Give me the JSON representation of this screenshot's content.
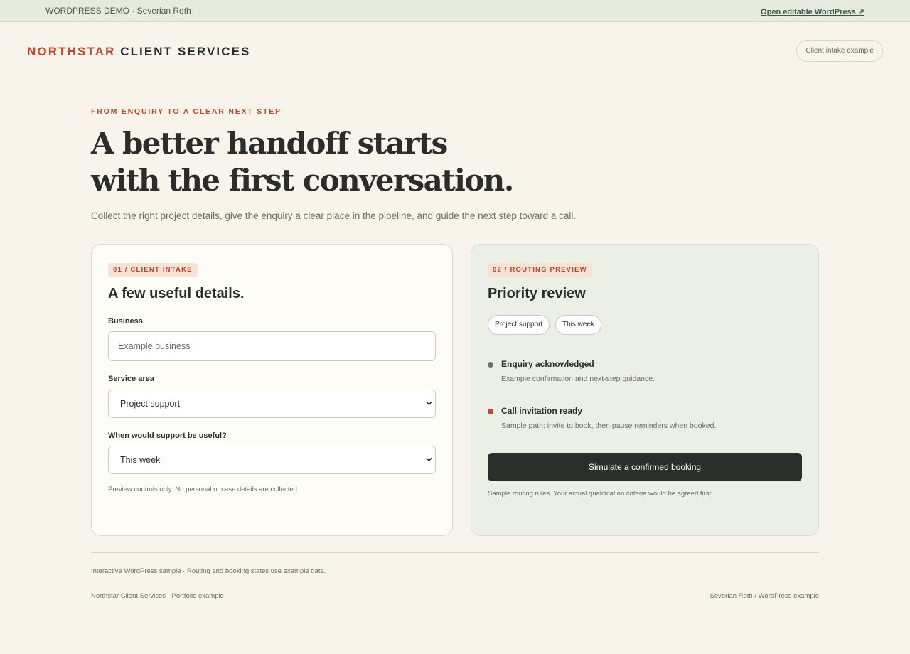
{
  "topbar": {
    "demo_label": "WORDPRESS DEMO · Severian Roth",
    "editable_link": "Open editable WordPress ↗"
  },
  "header": {
    "brand_accent": "NORTHSTAR",
    "brand_rest": "CLIENT SERVICES",
    "pill_label": "Client intake example"
  },
  "hero": {
    "eyebrow": "FROM ENQUIRY TO A CLEAR NEXT STEP",
    "title_line1": "A better handoff starts",
    "title_line2": "with the first conversation.",
    "lede": "Collect the right project details, give the enquiry a clear place in the pipeline, and guide the next step toward a call."
  },
  "intake": {
    "tag": "01 / CLIENT INTAKE",
    "title": "A few useful details.",
    "business_label": "Business",
    "business_placeholder": "Example business",
    "service_label": "Service area",
    "service_value": "Project support",
    "timing_label": "When would support be useful?",
    "timing_value": "This week",
    "note": "Preview controls only. No personal or case details are collected."
  },
  "routing": {
    "tag": "02 / ROUTING PREVIEW",
    "title": "Priority review",
    "chips": [
      "Project support",
      "This week"
    ],
    "steps": [
      {
        "title": "Enquiry acknowledged",
        "desc": "Example confirmation and next-step guidance.",
        "color": "#5f7a63"
      },
      {
        "title": "Call invitation ready",
        "desc": "Sample path: invite to book, then pause reminders when booked.",
        "color": "#bf4a2c"
      }
    ],
    "cta": "Simulate a confirmed booking",
    "footnote": "Sample routing rules. Your actual qualification criteria would be agreed first."
  },
  "footer": {
    "note": "Interactive WordPress sample · Routing and booking states use example data.",
    "left": "Northstar Client Services · Portfolio example",
    "right": "Severian Roth / WordPress example"
  },
  "colors": {
    "accent": "#bf4a2c",
    "dark": "#2b2f2b",
    "page_bg": "#f8f4ec",
    "routing_bg": "#ecefe5"
  }
}
